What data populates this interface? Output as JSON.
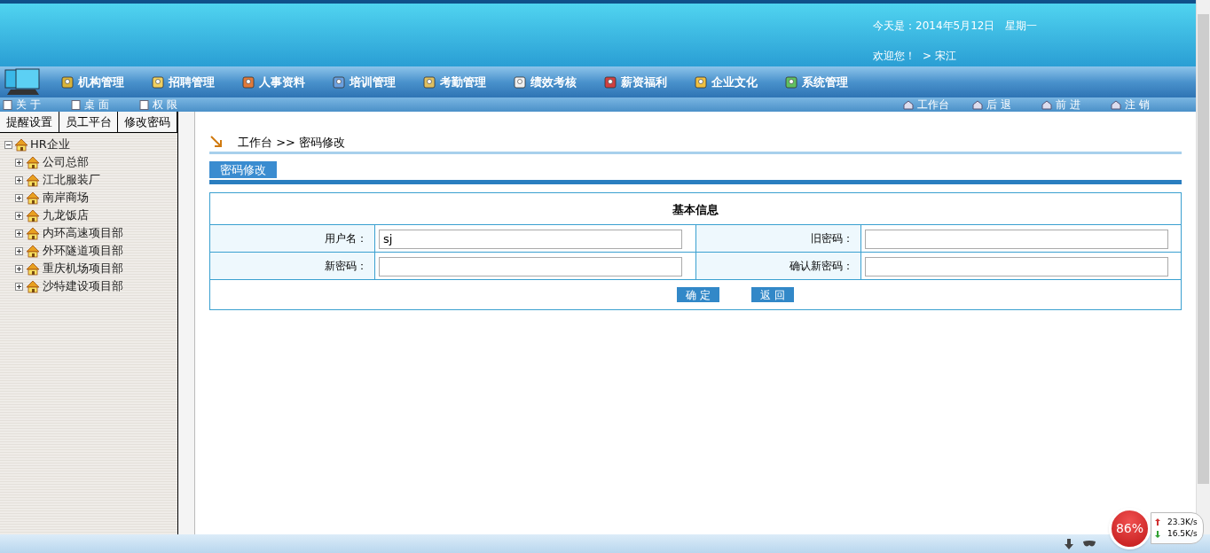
{
  "header": {
    "date": "今天是：2014年5月12日",
    "weekday": "星期一",
    "welcome": "欢迎您！",
    "user": "> 宋江"
  },
  "nav": [
    "机构管理",
    "招聘管理",
    "人事资料",
    "培训管理",
    "考勤管理",
    "绩效考核",
    "薪资福利",
    "企业文化",
    "系统管理"
  ],
  "toolbar_left": [
    "关 于",
    "桌 面",
    "权 限"
  ],
  "toolbar_right": [
    "工作台",
    "后 退",
    "前 进",
    "注 销"
  ],
  "sidebar": {
    "tabs": [
      "提醒设置",
      "员工平台",
      "修改密码"
    ],
    "tree": {
      "label": "HR企业",
      "expanded": true,
      "children": [
        {
          "label": "公司总部",
          "expanded": false
        },
        {
          "label": "江北服装厂",
          "expanded": false
        },
        {
          "label": "南岸商场",
          "expanded": false
        },
        {
          "label": "九龙饭店",
          "expanded": false
        },
        {
          "label": "内环高速项目部",
          "expanded": false
        },
        {
          "label": "外环隧道项目部",
          "expanded": false
        },
        {
          "label": "重庆机场项目部",
          "expanded": false
        },
        {
          "label": "沙特建设项目部",
          "expanded": false
        }
      ]
    }
  },
  "breadcrumb": "工作台 >> 密码修改",
  "section_tab": "密码修改",
  "form": {
    "title": "基本信息",
    "fields": [
      {
        "label": "用户名：",
        "value": "sj"
      },
      {
        "label": "旧密码："
      },
      {
        "label": "新密码："
      },
      {
        "label": "确认新密码："
      }
    ],
    "buttons": [
      "确 定",
      "返 回"
    ]
  },
  "network_widget": {
    "percent": "86%",
    "upload": "23.3K/s",
    "download": "16.5K/s"
  }
}
